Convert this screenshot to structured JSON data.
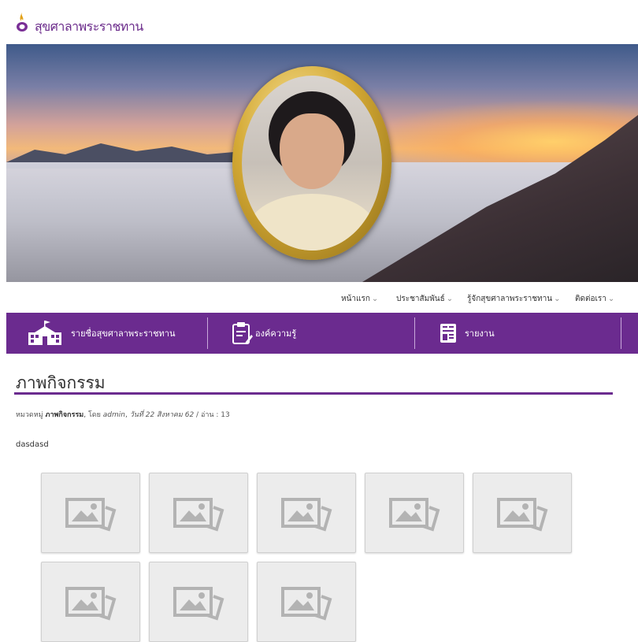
{
  "site": {
    "title": "สุขศาลาพระราชทาน",
    "logo_icon": "flame-logo-icon"
  },
  "nav_top": [
    {
      "label": "หน้าแรก"
    },
    {
      "label": "ประชาสัมพันธ์"
    },
    {
      "label": "รู้จักสุขศาลาพระราชทาน"
    },
    {
      "label": "ติดต่อเรา"
    }
  ],
  "menu": [
    {
      "label": "รายชื่อสุขศาลาพระราชทาน",
      "icon": "school-building-icon"
    },
    {
      "label": "องค์ความรู้",
      "icon": "clipboard-edit-icon"
    },
    {
      "label": "รายงาน",
      "icon": "report-document-icon"
    }
  ],
  "page": {
    "title": "ภาพกิจกรรม",
    "meta": {
      "category_prefix": "หมวดหมู่",
      "category": "ภาพกิจกรรม",
      "by_prefix": ", โดย",
      "author": "admin",
      "date": "วันที่ 22 สิงหาคม 62",
      "views": "/ อ่าน : 13"
    },
    "body": "dasdasd"
  },
  "gallery": {
    "count": 8,
    "placeholder_icon": "image-placeholder-icon"
  },
  "colors": {
    "brand_purple": "#6b2b8f",
    "placeholder_gray": "#ececec"
  }
}
